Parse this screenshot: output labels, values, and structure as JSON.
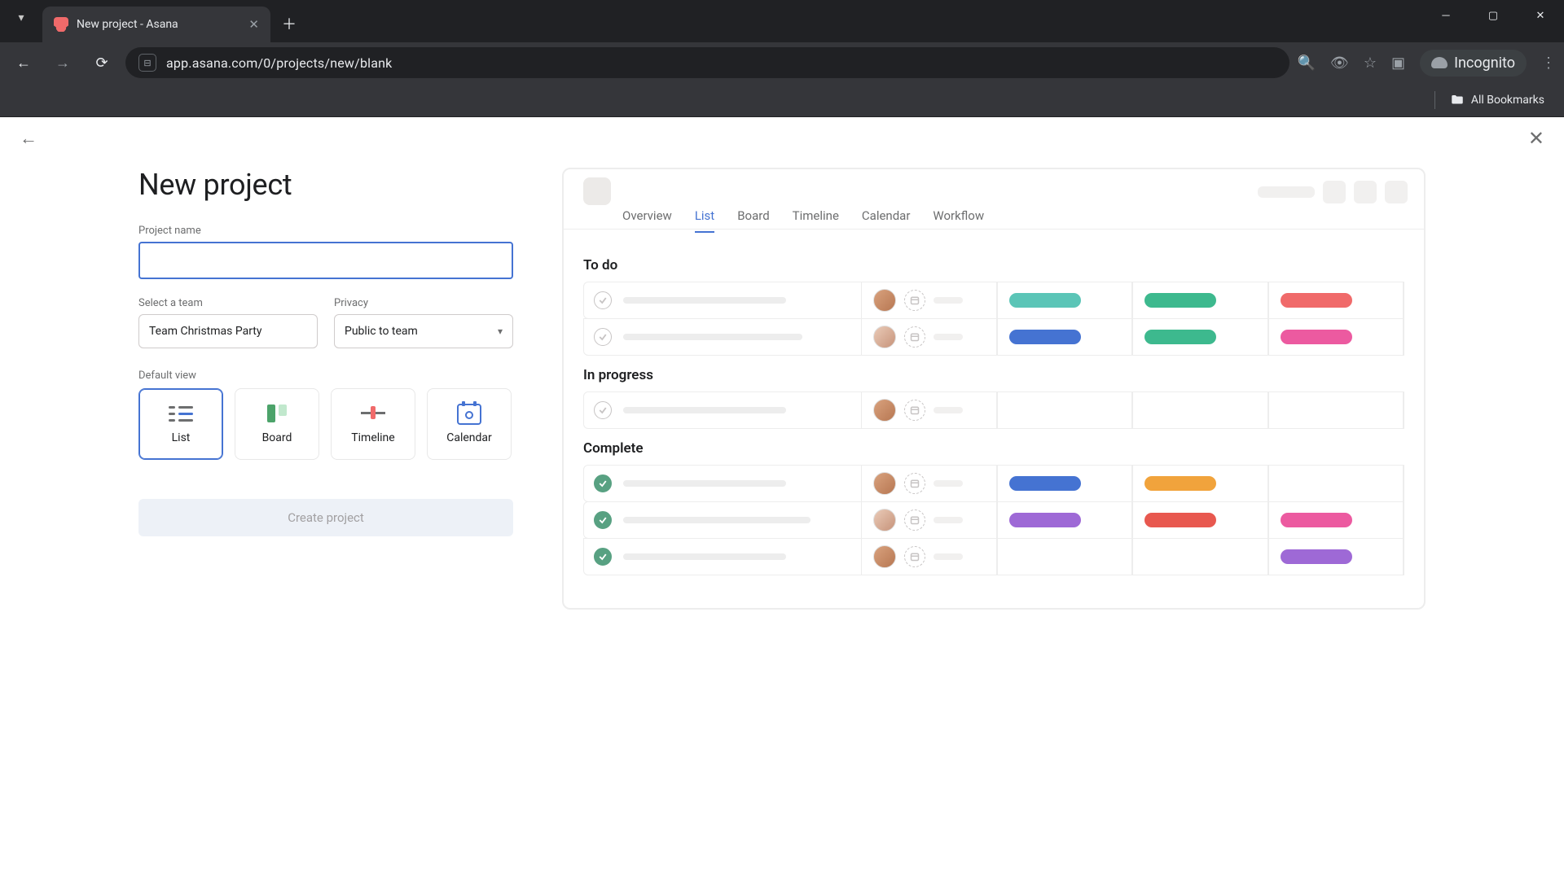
{
  "browser": {
    "tab_title": "New project - Asana",
    "url": "app.asana.com/0/projects/new/blank",
    "incognito_label": "Incognito",
    "all_bookmarks": "All Bookmarks"
  },
  "page": {
    "heading": "New project",
    "labels": {
      "project_name": "Project name",
      "select_team": "Select a team",
      "privacy": "Privacy",
      "default_view": "Default view"
    },
    "team_value": "Team Christmas Party",
    "privacy_value": "Public to team",
    "views": {
      "list": "List",
      "board": "Board",
      "timeline": "Timeline",
      "calendar": "Calendar"
    },
    "create_button": "Create project"
  },
  "preview": {
    "tabs": {
      "overview": "Overview",
      "list": "List",
      "board": "Board",
      "timeline": "Timeline",
      "calendar": "Calendar",
      "workflow": "Workflow"
    },
    "sections": {
      "todo": "To do",
      "in_progress": "In progress",
      "complete": "Complete"
    }
  }
}
